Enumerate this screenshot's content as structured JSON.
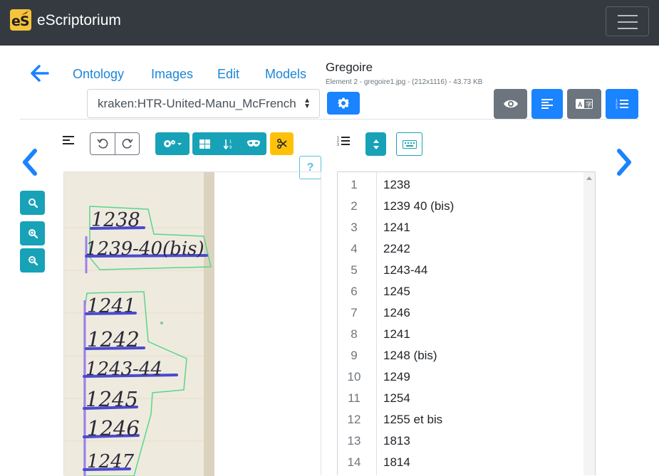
{
  "app": {
    "brand_logo_text": "eS",
    "brand_name": "eScriptorium"
  },
  "tabs": [
    {
      "label": "Ontology"
    },
    {
      "label": "Images"
    },
    {
      "label": "Edit"
    },
    {
      "label": "Models"
    }
  ],
  "document": {
    "title": "Gregoire",
    "subtitle": "Element 2 - gregoire1.jpg - (212x1116) - 43.73 KB"
  },
  "model_select": {
    "value": "kraken:HTR-United-Manu_McFrench"
  },
  "help": {
    "label": "?"
  },
  "transcription": {
    "lines": [
      {
        "num": "1",
        "text": "1238"
      },
      {
        "num": "2",
        "text": "1239 40 (bis)"
      },
      {
        "num": "3",
        "text": "1241"
      },
      {
        "num": "4",
        "text": "2242"
      },
      {
        "num": "5",
        "text": "1243-44"
      },
      {
        "num": "6",
        "text": "1245"
      },
      {
        "num": "7",
        "text": "1246"
      },
      {
        "num": "8",
        "text": "1241"
      },
      {
        "num": "9",
        "text": "1248 (bis)"
      },
      {
        "num": "10",
        "text": "1249"
      },
      {
        "num": "11",
        "text": "1254"
      },
      {
        "num": "12",
        "text": "1255 et bis"
      },
      {
        "num": "13",
        "text": "1813"
      },
      {
        "num": "14",
        "text": "1814"
      }
    ]
  },
  "scan": {
    "handwriting": [
      "1238",
      "1239-40(bis)",
      "1241",
      "1242",
      "1243-44",
      "1245",
      "1246",
      "1247"
    ]
  },
  "colors": {
    "navbar": "#343a40",
    "primary": "#1a83ff",
    "info": "#17a2b8",
    "secondary": "#6c757d",
    "warning": "#ffc107",
    "link": "#1b86d8",
    "baseline": "#4a4ad0",
    "region": "#58d68d"
  },
  "icons": {
    "back": "arrow-left-icon",
    "settings": "gear-icon",
    "visibility": "eye-icon",
    "segmentation_panel": "align-left-icon",
    "translation_panel": "translate-icon",
    "text_panel": "list-ordered-icon",
    "previous": "chevron-left-icon",
    "next": "chevron-right-icon",
    "search": "search-icon",
    "zoom_in": "zoom-in-icon",
    "zoom_out": "zoom-out-icon",
    "undo": "undo-icon",
    "redo": "redo-icon",
    "tools": "cogs-icon",
    "regions": "grid-icon",
    "reorder": "sort-icon",
    "mask": "mask-icon",
    "cut": "scissors-icon",
    "sort_lines": "sort-vertical-icon",
    "keyboard": "keyboard-icon"
  }
}
